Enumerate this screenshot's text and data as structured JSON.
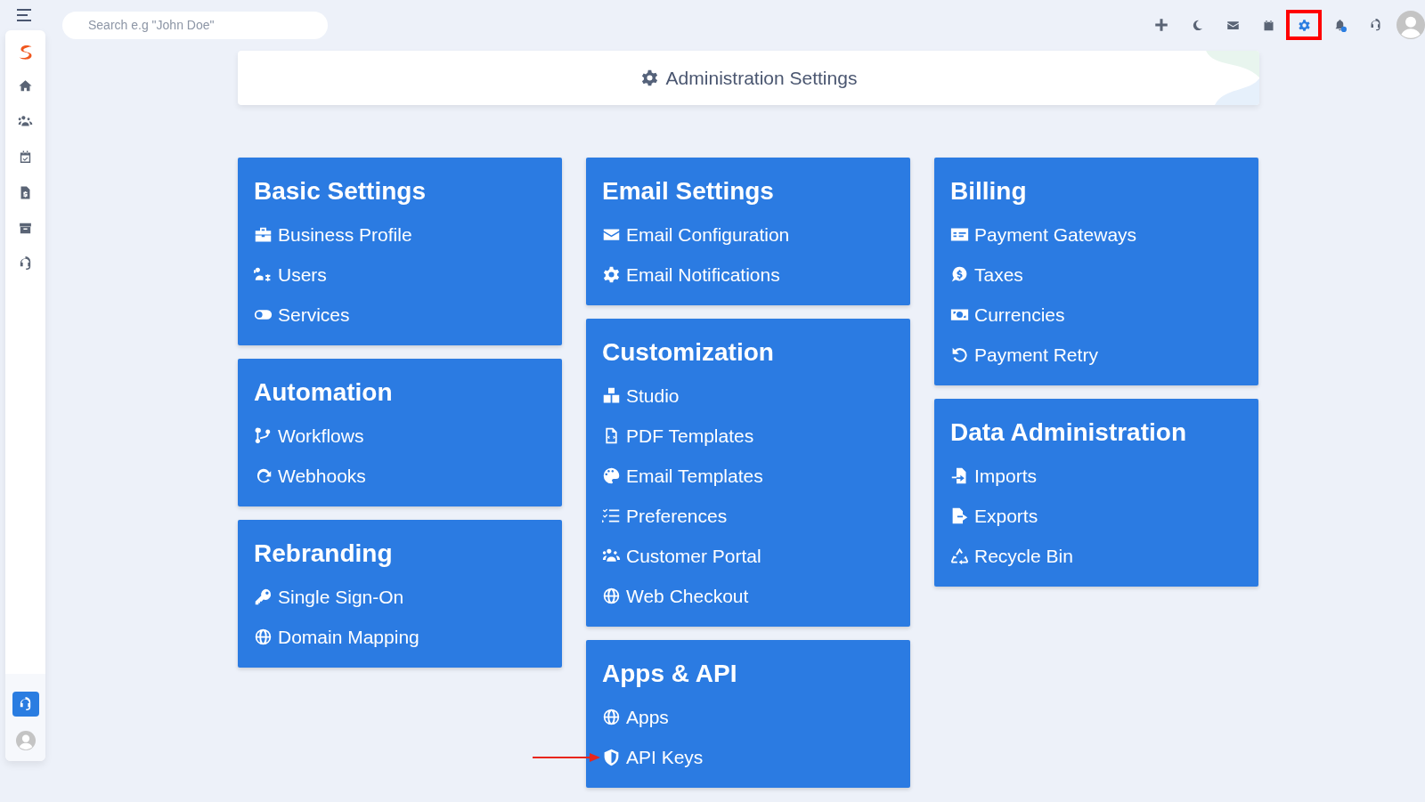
{
  "search": {
    "placeholder": "Search e.g \"John Doe\""
  },
  "sidebar": {
    "items": [
      {
        "selected": false
      },
      {
        "selected": false
      },
      {
        "selected": false
      },
      {
        "selected": false
      },
      {
        "selected": false
      },
      {
        "selected": false
      },
      {
        "selected": true
      }
    ]
  },
  "toolbar": {
    "buttons": [
      {
        "highlighted": false
      },
      {
        "highlighted": false
      },
      {
        "highlighted": false
      },
      {
        "highlighted": false
      },
      {
        "highlighted": true
      },
      {
        "highlighted": false
      },
      {
        "highlighted": false
      }
    ]
  },
  "header": {
    "title": "Administration Settings"
  },
  "columns": [
    [
      {
        "title": "Basic Settings",
        "items": [
          {
            "label": "Business Profile"
          },
          {
            "label": "Users"
          },
          {
            "label": "Services"
          }
        ]
      },
      {
        "title": "Automation",
        "items": [
          {
            "label": "Workflows"
          },
          {
            "label": "Webhooks"
          }
        ]
      },
      {
        "title": "Rebranding",
        "items": [
          {
            "label": "Single Sign-On"
          },
          {
            "label": "Domain Mapping"
          }
        ]
      }
    ],
    [
      {
        "title": "Email Settings",
        "items": [
          {
            "label": "Email Configuration"
          },
          {
            "label": "Email Notifications"
          }
        ]
      },
      {
        "title": "Customization",
        "items": [
          {
            "label": "Studio"
          },
          {
            "label": "PDF Templates"
          },
          {
            "label": "Email Templates"
          },
          {
            "label": "Preferences"
          },
          {
            "label": "Customer Portal"
          },
          {
            "label": "Web Checkout"
          }
        ]
      },
      {
        "title": "Apps & API",
        "items": [
          {
            "label": "Apps"
          },
          {
            "label": "API Keys",
            "pointed": true
          }
        ]
      }
    ],
    [
      {
        "title": "Billing",
        "items": [
          {
            "label": "Payment Gateways"
          },
          {
            "label": "Taxes"
          },
          {
            "label": "Currencies"
          },
          {
            "label": "Payment Retry"
          }
        ]
      },
      {
        "title": "Data Administration",
        "items": [
          {
            "label": "Imports"
          },
          {
            "label": "Exports"
          },
          {
            "label": "Recycle Bin"
          }
        ]
      }
    ]
  ]
}
